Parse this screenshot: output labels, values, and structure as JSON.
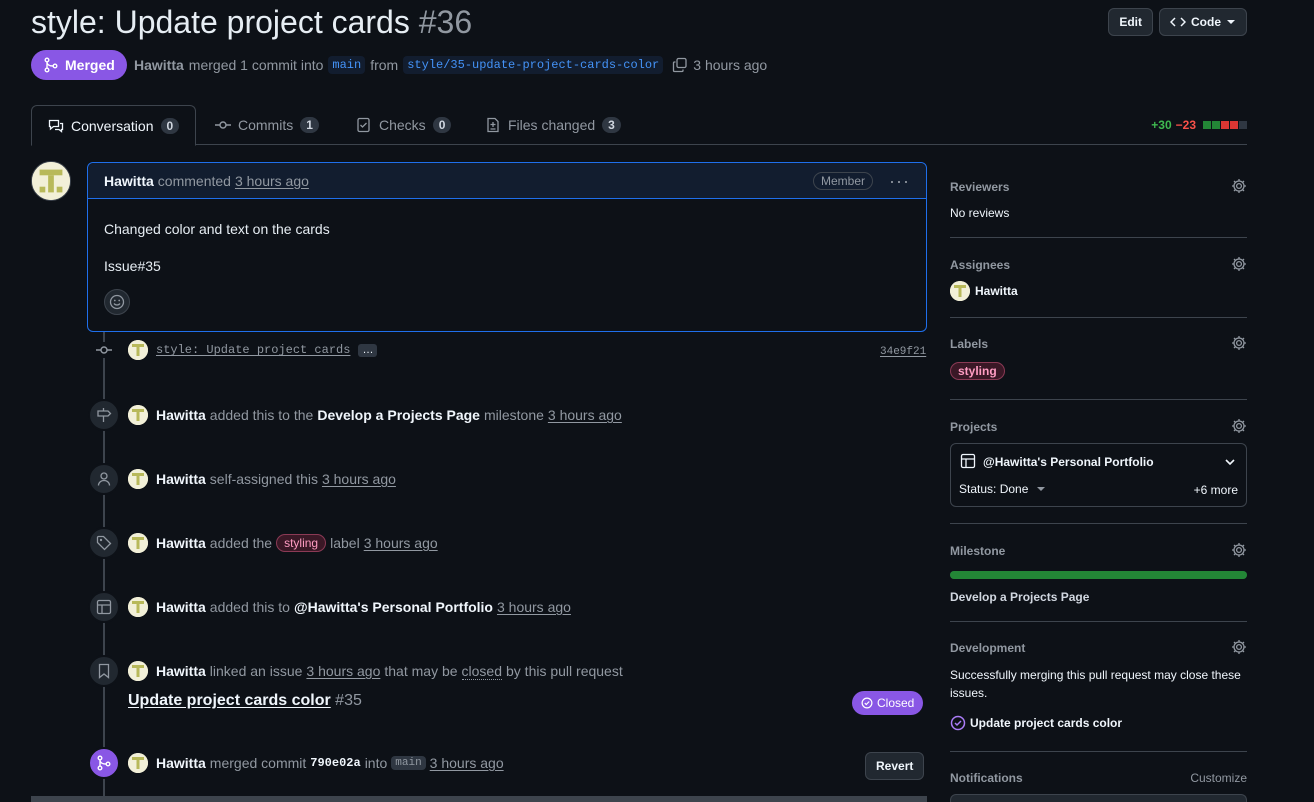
{
  "pr": {
    "title": "style: Update project cards",
    "number": "#36",
    "state": "Merged",
    "author": "Hawitta",
    "merged_text": "merged 1 commit into",
    "base_branch": "main",
    "from_text": "from",
    "head_branch": "style/35-update-project-cards-color",
    "time": "3 hours ago"
  },
  "header": {
    "edit_label": "Edit",
    "code_label": "Code"
  },
  "tabs": [
    {
      "label": "Conversation",
      "count": "0"
    },
    {
      "label": "Commits",
      "count": "1"
    },
    {
      "label": "Checks",
      "count": "0"
    },
    {
      "label": "Files changed",
      "count": "3"
    }
  ],
  "diffstat": {
    "additions": "+30",
    "deletions": "−23"
  },
  "comment": {
    "author": "Hawitta",
    "action": "commented",
    "time": "3 hours ago",
    "role": "Member",
    "line1": "Changed color and text on the cards",
    "line2": "Issue#35"
  },
  "timeline": {
    "commit_message": "style: Update project cards",
    "commit_sha": "34e9f21",
    "ellipsis": "…",
    "milestone": {
      "user": "Hawitta",
      "pre": "added this to the",
      "name": "Develop a Projects Page",
      "post": "milestone",
      "time": "3 hours ago"
    },
    "assign": {
      "user": "Hawitta",
      "text": "self-assigned this",
      "time": "3 hours ago"
    },
    "label": {
      "user": "Hawitta",
      "pre": "added the",
      "label": "styling",
      "post": "label",
      "time": "3 hours ago"
    },
    "project": {
      "user": "Hawitta",
      "pre": "added this to",
      "name": "@Hawitta's Personal Portfolio",
      "time": "3 hours ago"
    },
    "link": {
      "user": "Hawitta",
      "pre": "linked an issue",
      "time": "3 hours ago",
      "mid": "that may be",
      "closed_word": "closed",
      "post": "by this pull request",
      "issue_title": "Update project cards color",
      "issue_number": "#35",
      "issue_state": "Closed"
    },
    "merge": {
      "user": "Hawitta",
      "pre": "merged commit",
      "sha": "790e02a",
      "into": "into",
      "branch": "main",
      "time": "3 hours ago",
      "revert_label": "Revert"
    }
  },
  "sidebar": {
    "reviewers": {
      "title": "Reviewers",
      "value": "No reviews"
    },
    "assignees": {
      "title": "Assignees",
      "value": "Hawitta"
    },
    "labels": {
      "title": "Labels",
      "value": "styling"
    },
    "projects": {
      "title": "Projects",
      "name": "@Hawitta's Personal Portfolio",
      "status": "Status: Done",
      "more": "+6 more"
    },
    "milestone": {
      "title": "Milestone",
      "name": "Develop a Projects Page",
      "progress": 1.0
    },
    "development": {
      "title": "Development",
      "text": "Successfully merging this pull request may close these issues.",
      "issue": "Update project cards color"
    },
    "notifications": {
      "title": "Notifications",
      "action": "Customize"
    }
  },
  "colors": {
    "merged_purple": "#8957e5",
    "accent_blue": "#4493f8",
    "green": "#238636",
    "red": "#f85149"
  }
}
